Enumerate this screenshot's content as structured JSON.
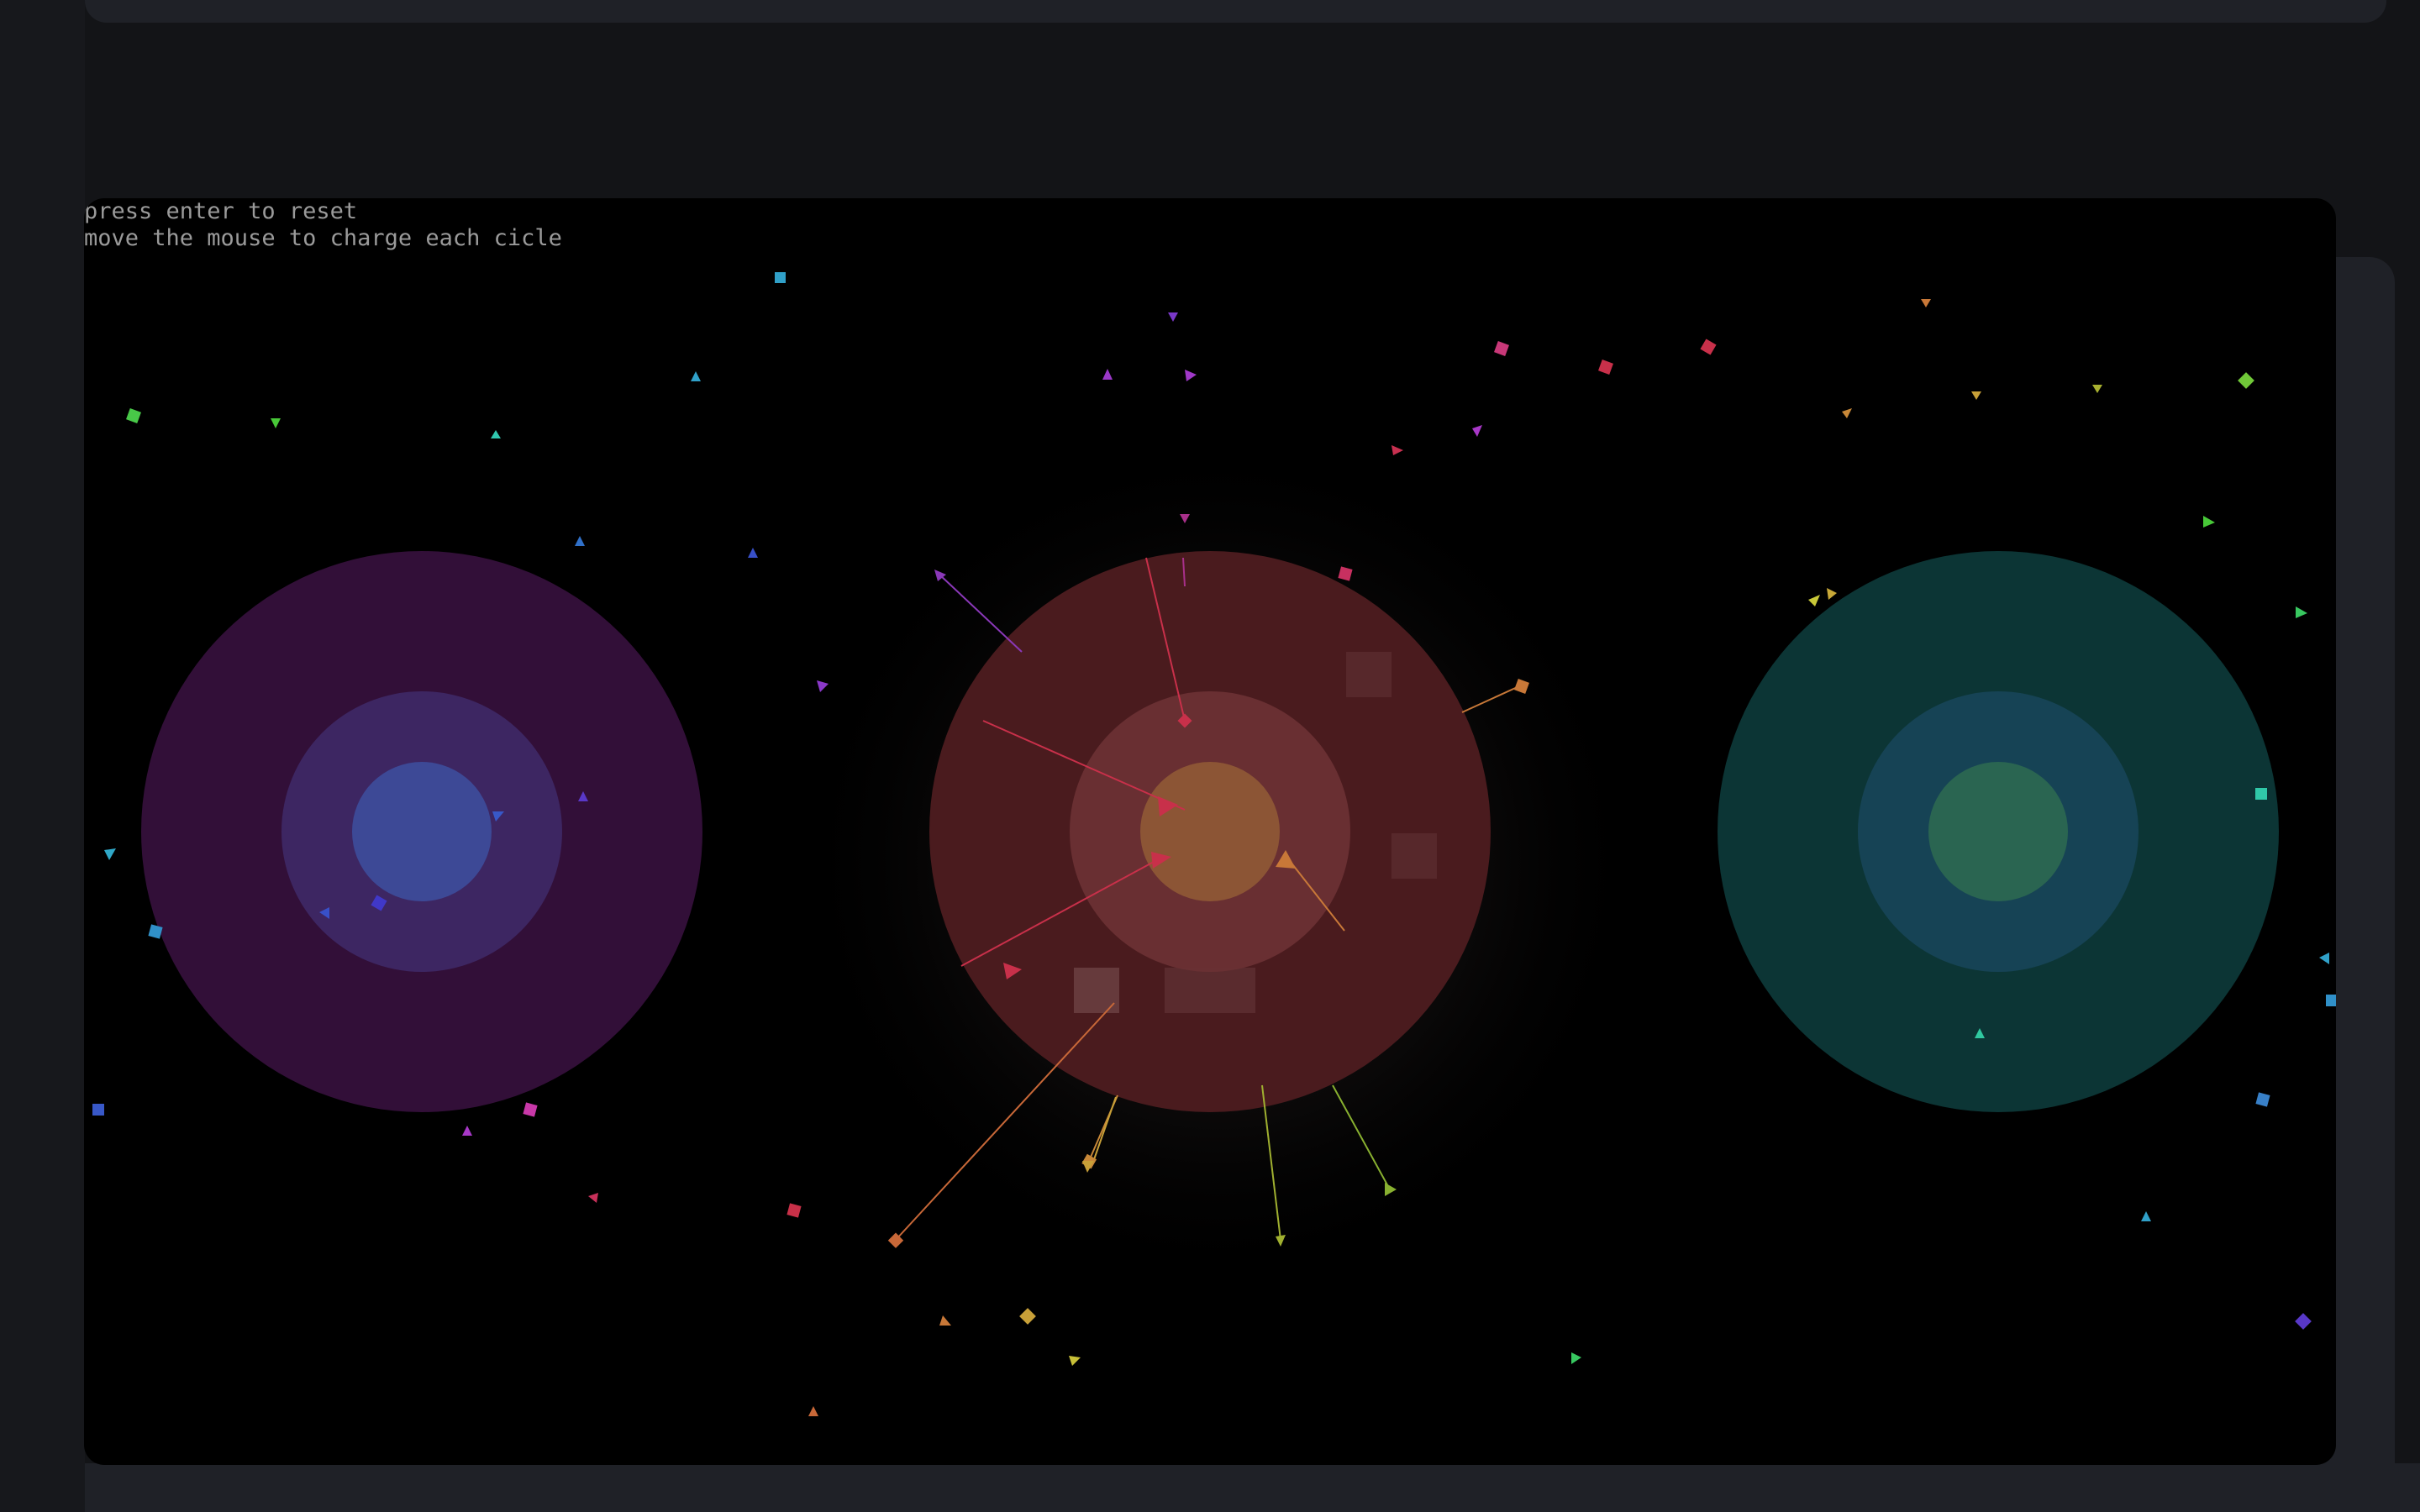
{
  "hud": {
    "reset_hint": "press enter to reset",
    "charge_hint": "move the mouse to charge each cicle"
  },
  "colors": {
    "page_background": "#131417",
    "panel": "#1f2127",
    "canvas_background": "#000000",
    "hud_text": "#9a9a9a",
    "violet_circle": {
      "outer": "#320f38",
      "middle": "#3d2662",
      "inner": "#3d4996"
    },
    "red_circle": {
      "outer": "#4a1b1e",
      "middle": "#6a3034",
      "inner": "#8e5736"
    },
    "teal_circle": {
      "outer": "#0c3535",
      "middle": "#164355",
      "inner": "#2a6551"
    }
  },
  "circles": [
    {
      "name": "violet-cicle",
      "charged": false
    },
    {
      "name": "red-cicle",
      "charged": true
    },
    {
      "name": "teal-cicle",
      "charged": false
    }
  ]
}
